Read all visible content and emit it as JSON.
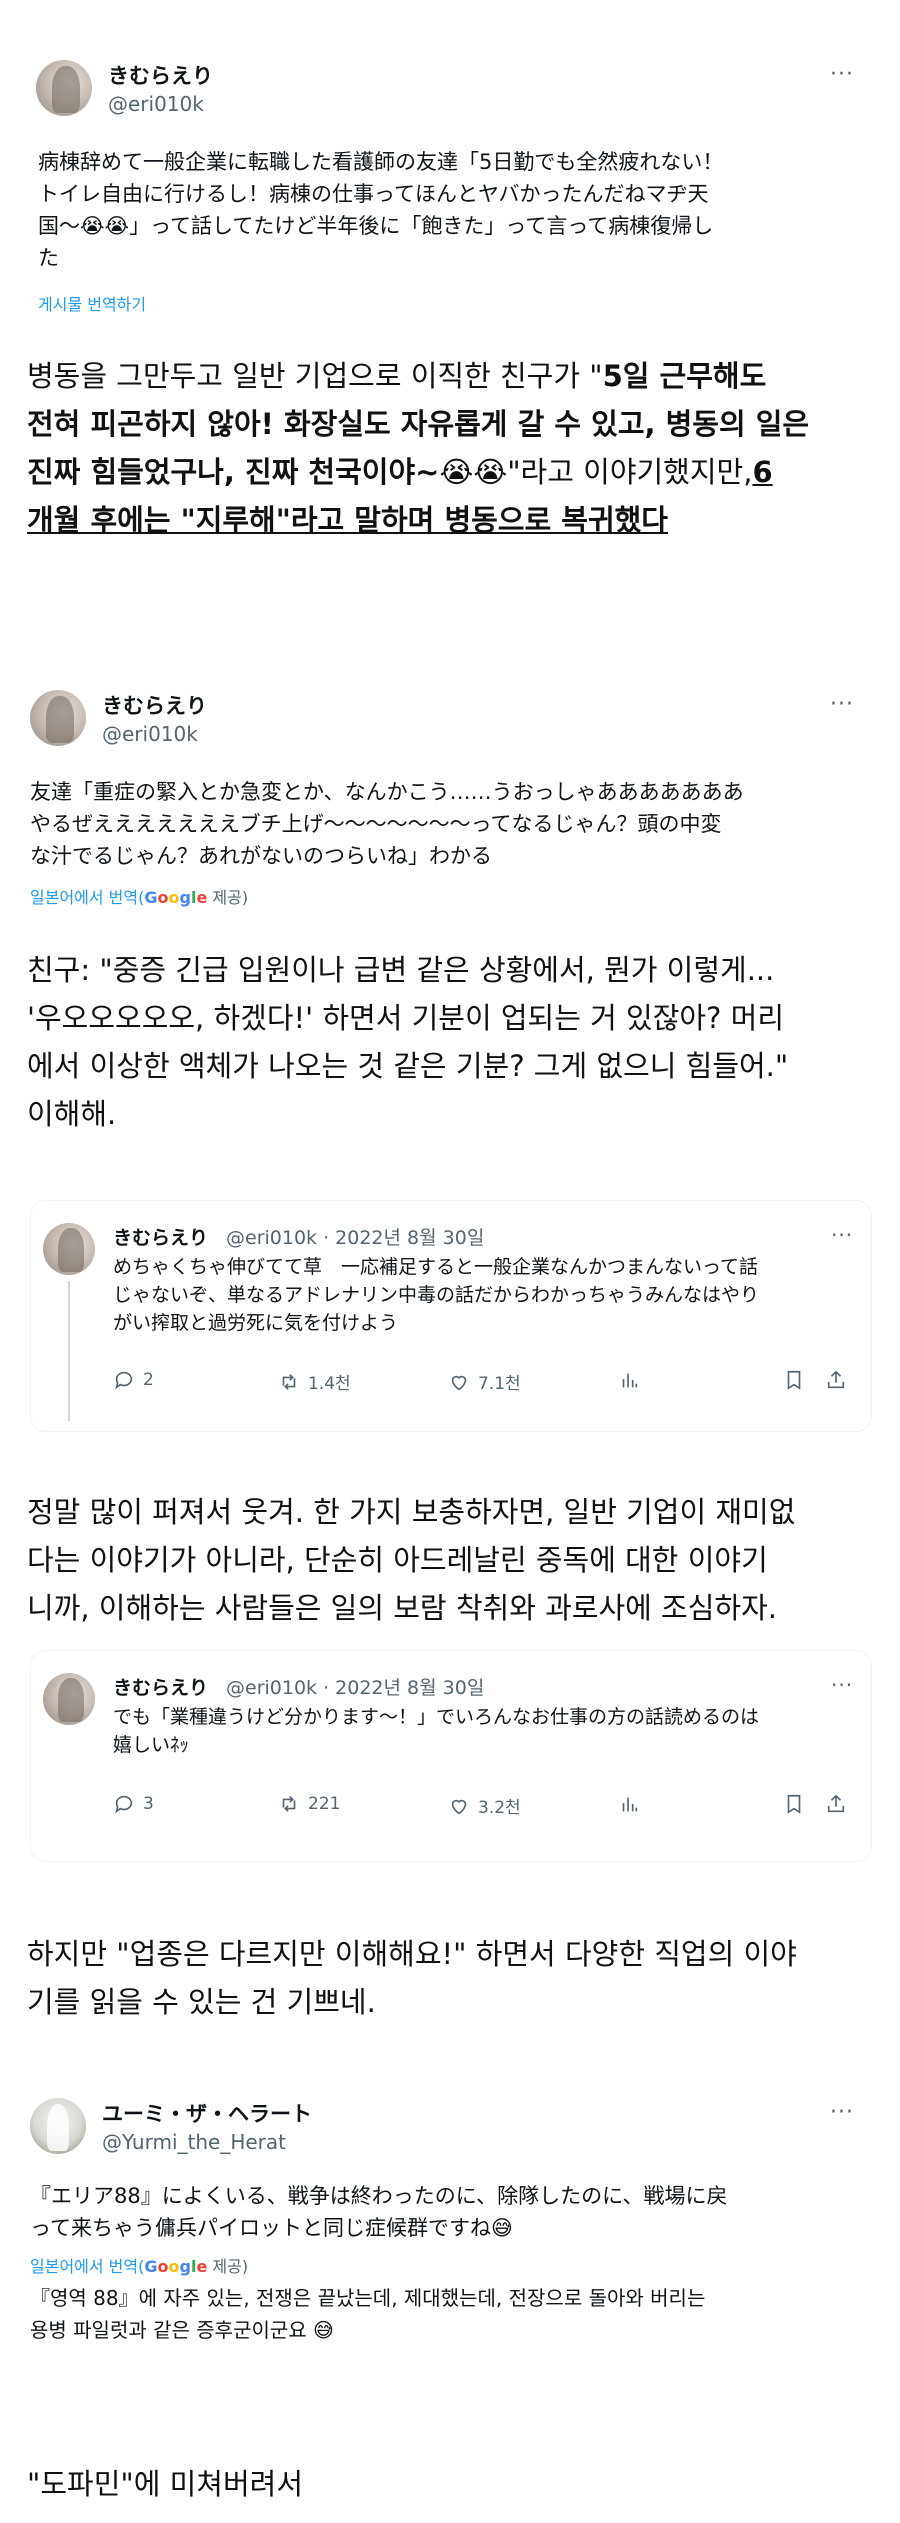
{
  "tweet1": {
    "name": "きむらえり",
    "handle": "@eri010k",
    "text_lines": [
      "病棟辞めて一般企業に転職した看護師の友達「5日勤でも全然疲れない！",
      "トイレ自由に行けるし！病棟の仕事ってほんとヤバかったんだねマヂ天",
      "国〜😭😭」って話してたけど半年後に「飽きた」って言って病棟復帰し",
      "た"
    ],
    "translate_label": "게시물 번역하기"
  },
  "ko1": {
    "lines": [
      "병동을 그만두고 일반 기업으로 이직한 친구가 \"",
      "5일 근무해도",
      "전혀 피곤하지 않아! 화장실도 자유롭게 갈 수 있고, 병동의 일은",
      "진짜 힘들었구나, 진짜 천국이야~😭😭",
      "\"라고 이야기했지만,",
      "6",
      "개월 후에는 \"지루해\"라고 말하며 병동으로 복귀했다"
    ]
  },
  "tweet2": {
    "name": "きむらえり",
    "handle": "@eri010k",
    "text_lines": [
      "友達「重症の緊入とか急変とか、なんかこう……うおっしゃあああああああ",
      "やるぜえええええええブチ上げ〜〜〜〜〜〜〜ってなるじゃん？頭の中変",
      "な汁でるじゃん？あれがないのつらいね」わかる"
    ],
    "translate_prefix": "일본어에서 번역(",
    "google": "Google",
    "translate_suffix": " 제공)"
  },
  "ko2": {
    "lines": [
      "친구: \"중증 긴급 입원이나 급변 같은 상황에서, 뭔가 이렇게...",
      "'우오오오오오, 하겠다!' 하면서 기분이 업되는 거 있잖아? 머리",
      "에서 이상한 액체가 나오는 것 같은 기분? 그게 없으니 힘들어.\"",
      "이해해."
    ]
  },
  "card1": {
    "name": "きむらえり",
    "handle": "@eri010k · 2022년 8월 30일",
    "text_lines": [
      "めちゃくちゃ伸びてて草　一応補足すると一般企業なんかつまんないって話",
      "じゃないぞ、単なるアドレナリン中毒の話だからわかっちゃうみんなはやり",
      "がい搾取と過労死に気を付けよう"
    ],
    "replies": "2",
    "retweets": "1.4천",
    "likes": "7.1천"
  },
  "ko3": {
    "lines": [
      "정말 많이 퍼져서 웃겨. 한 가지 보충하자면, 일반 기업이 재미없",
      "다는 이야기가 아니라, 단순히 아드레날린 중독에 대한 이야기",
      "니까, 이해하는 사람들은 일의 보람 착취와 과로사에 조심하자."
    ]
  },
  "card2": {
    "name": "きむらえり",
    "handle": "@eri010k · 2022년 8월 30일",
    "text_lines": [
      "でも「業種違うけど分かります〜！」でいろんなお仕事の方の話読めるのは",
      "嬉しいﾈｯ"
    ],
    "replies": "3",
    "retweets": "221",
    "likes": "3.2천"
  },
  "ko4": {
    "lines": [
      "하지만 \"업종은 다르지만 이해해요!\" 하면서 다양한 직업의 이야",
      "기를 읽을 수 있는 건 기쁘네."
    ]
  },
  "tweet3": {
    "name": "ユーミ・ザ・ヘラート",
    "handle": "@Yurmi_the_Herat",
    "text_lines": [
      "『エリア88』によくいる、戦争は終わったのに、除隊したのに、戦場に戻",
      "って来ちゃう傭兵パイロットと同じ症候群ですね😅"
    ],
    "translate_prefix": "일본어에서 번역(",
    "google": "Google",
    "translate_suffix": " 제공)",
    "translated_lines": [
      "『영역 88』에 자주 있는, 전쟁은 끝났는데, 제대했는데, 전장으로 돌아와 버리는",
      "용병 파일럿과 같은 증후군이군요 😅"
    ]
  },
  "ko5": {
    "lines": [
      "\"도파민\"에 미쳐버려서"
    ]
  },
  "colors": {
    "accent": "#1d9bf0",
    "muted": "#536471",
    "text": "#0f1419",
    "border": "#eff3f4"
  },
  "icons": [
    "more-dots-icon",
    "reply-icon",
    "retweet-icon",
    "like-icon",
    "views-icon",
    "bookmark-icon",
    "share-icon"
  ]
}
